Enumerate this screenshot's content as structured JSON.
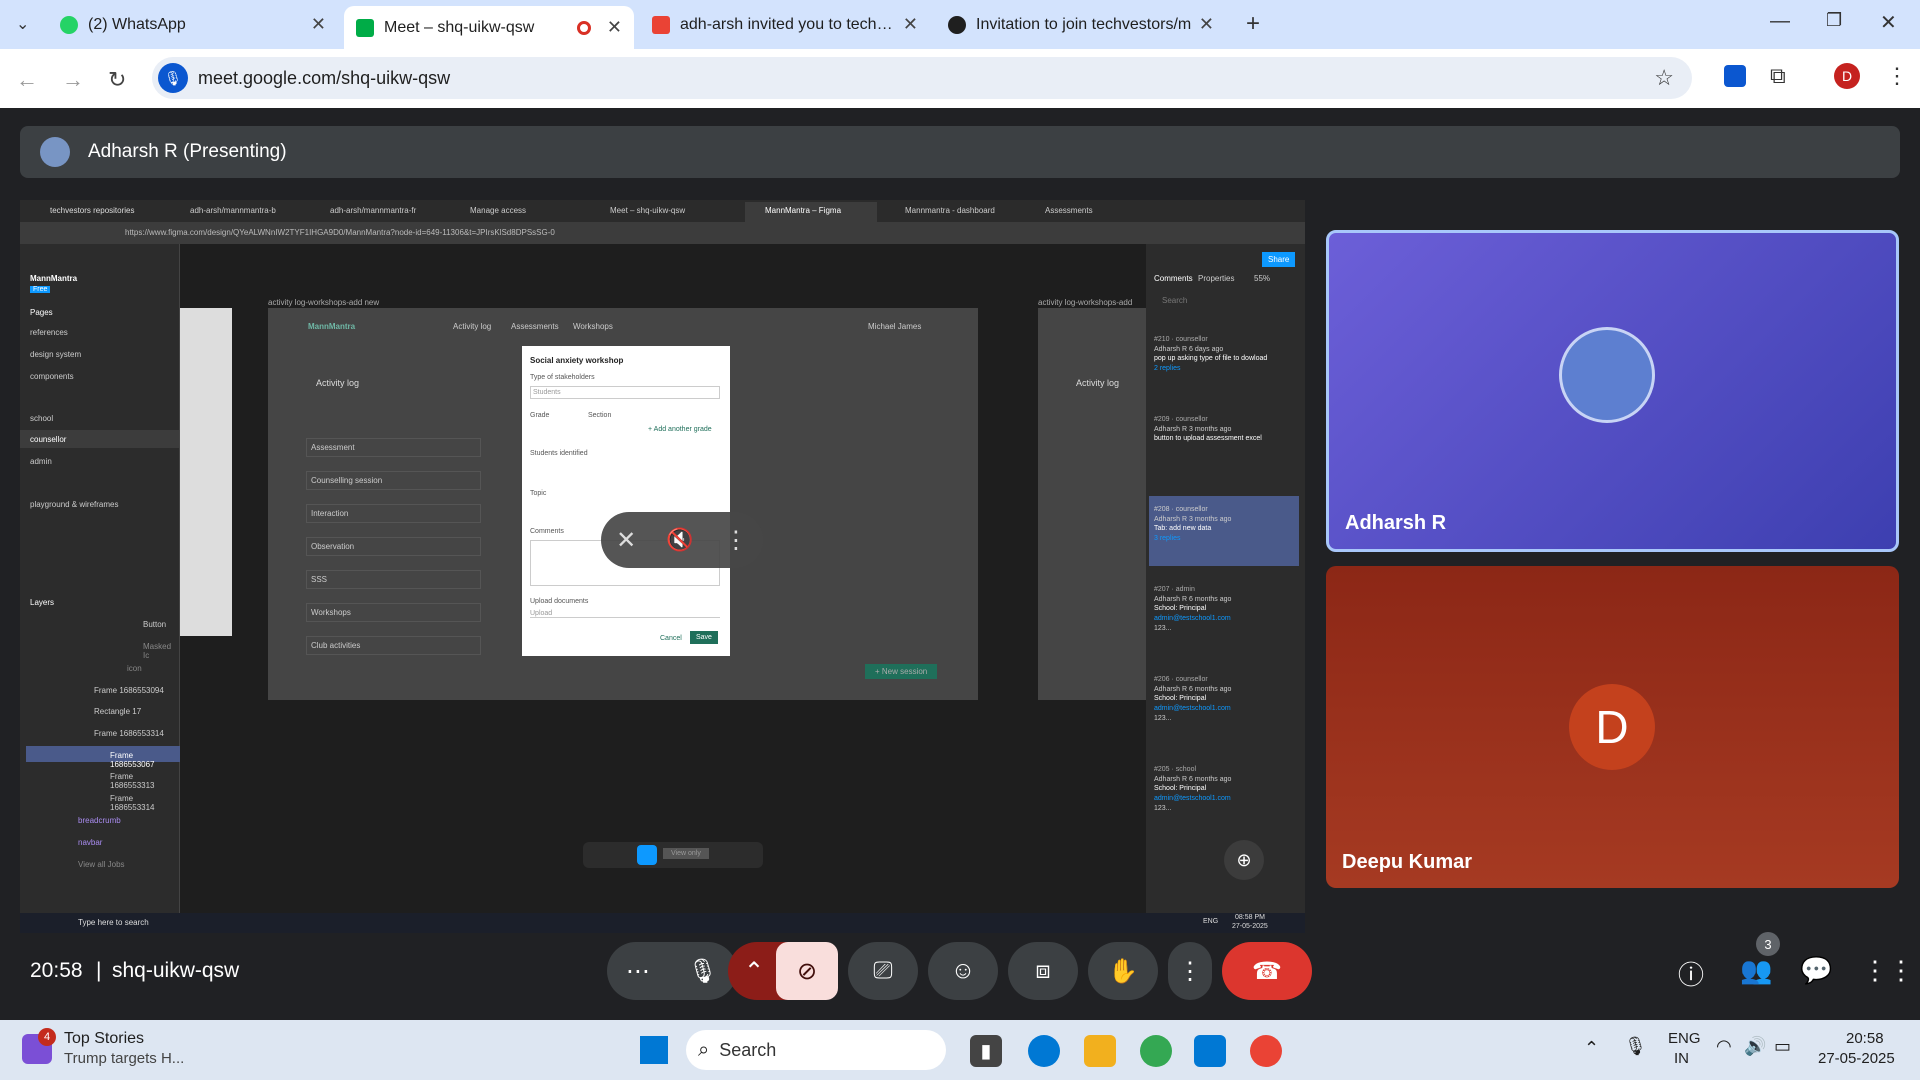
{
  "browser": {
    "tabs": [
      {
        "label": "(2) WhatsApp"
      },
      {
        "label": "Meet – shq-uikw-qsw"
      },
      {
        "label": "adh-arsh invited you to techves"
      },
      {
        "label": "Invitation to join techvestors/m"
      }
    ],
    "url": "meet.google.com/shq-uikw-qsw",
    "profile_initial": "D"
  },
  "meet": {
    "presenter_label": "Adharsh R (Presenting)",
    "time": "20:58",
    "separator": "|",
    "meeting_code": "shq-uikw-qsw",
    "participant_count": "3",
    "participants": [
      {
        "name": "Adharsh R"
      },
      {
        "name": "Deepu Kumar",
        "initial": "D"
      }
    ]
  },
  "shared": {
    "tabs": [
      "techvestors repositories",
      "adh-arsh/mannmantra-b",
      "adh-arsh/mannmantra-fr",
      "Manage access",
      "Meet – shq-uikw-qsw",
      "MannMantra – Figma",
      "Mannmantra - dashboard",
      "Assessments"
    ],
    "url": "https://www.figma.com/design/QYeALWNnIW2TYF1IHGA9D0/MannMantra?node-id=649-11306&t=JPIrsKlSd8DPSsSG-0",
    "project": "MannMantra",
    "plan": "Free",
    "pages_title": "Pages",
    "pages": [
      "references",
      "design system",
      "components",
      "school",
      "counsellor",
      "admin",
      "playground & wireframes"
    ],
    "layers_title": "Layers",
    "layers": [
      "Button",
      "Masked Ic",
      "icon",
      "Frame 1686553094",
      "Rectangle 17",
      "Frame 1686553314",
      "Frame 1686553067",
      "Frame 1686553313",
      "Frame 1686553314",
      "breadcrumb",
      "navbar",
      "View all Jobs"
    ],
    "frame_label": "activity log-workshops-add new",
    "brand": "MannMantra",
    "nav": [
      "Activity log",
      "Assessments",
      "Workshops"
    ],
    "user": "Michael James",
    "section": "Activity log",
    "list": [
      "Assessment",
      "Counselling session",
      "Interaction",
      "Observation",
      "SSS",
      "Workshops",
      "Club activities"
    ],
    "modal": {
      "title": "Social anxiety workshop",
      "f1": "Type of stakeholders",
      "f1v": "Students",
      "grade": "Grade",
      "section": "Section",
      "add_grade": "+ Add another grade",
      "students": "Students identified",
      "topic": "Topic",
      "comments": "Comments",
      "upload": "Upload documents",
      "upload_ph": "Upload",
      "cancel": "Cancel",
      "save": "Save"
    },
    "new_session": "+ New session",
    "right_tabs": [
      "Comments",
      "Properties"
    ],
    "zoom": "55%",
    "share": "Share",
    "search": "Search",
    "view_only": "View only",
    "comments": [
      {
        "id": "#210 · counsellor",
        "meta": "Adharsh R 6 days ago",
        "text": "pop up asking type of file to dowload",
        "replies": "2 replies"
      },
      {
        "id": "#209 · counsellor",
        "meta": "Adharsh R 3 months ago",
        "text": "button to upload assessment excel",
        "replies": ""
      },
      {
        "id": "#208 · counsellor",
        "meta": "Adharsh R 3 months ago",
        "text": "Tab: add new data",
        "replies": "3 replies"
      },
      {
        "id": "#207 · admin",
        "meta": "Adharsh R 6 months ago",
        "text": "School: Principal",
        "email": "admin@testschool1.com",
        "more": "123..."
      },
      {
        "id": "#206 · counsellor",
        "meta": "Adharsh R 6 months ago",
        "text": "School: Principal",
        "email": "admin@testschool1.com",
        "more": "123..."
      },
      {
        "id": "#205 · school",
        "meta": "Adharsh R 6 months ago",
        "text": "School: Principal",
        "email": "admin@testschool1.com",
        "more": "123..."
      }
    ],
    "taskbar_search": "Type here to search",
    "lang": "ENG",
    "clock": "08:58 PM",
    "date": "27-05-2025"
  },
  "taskbar": {
    "news_badge": "4",
    "news_title": "Top Stories",
    "news_sub": "Trump targets H...",
    "search": "Search",
    "lang1": "ENG",
    "lang2": "IN",
    "time": "20:58",
    "date": "27-05-2025"
  }
}
